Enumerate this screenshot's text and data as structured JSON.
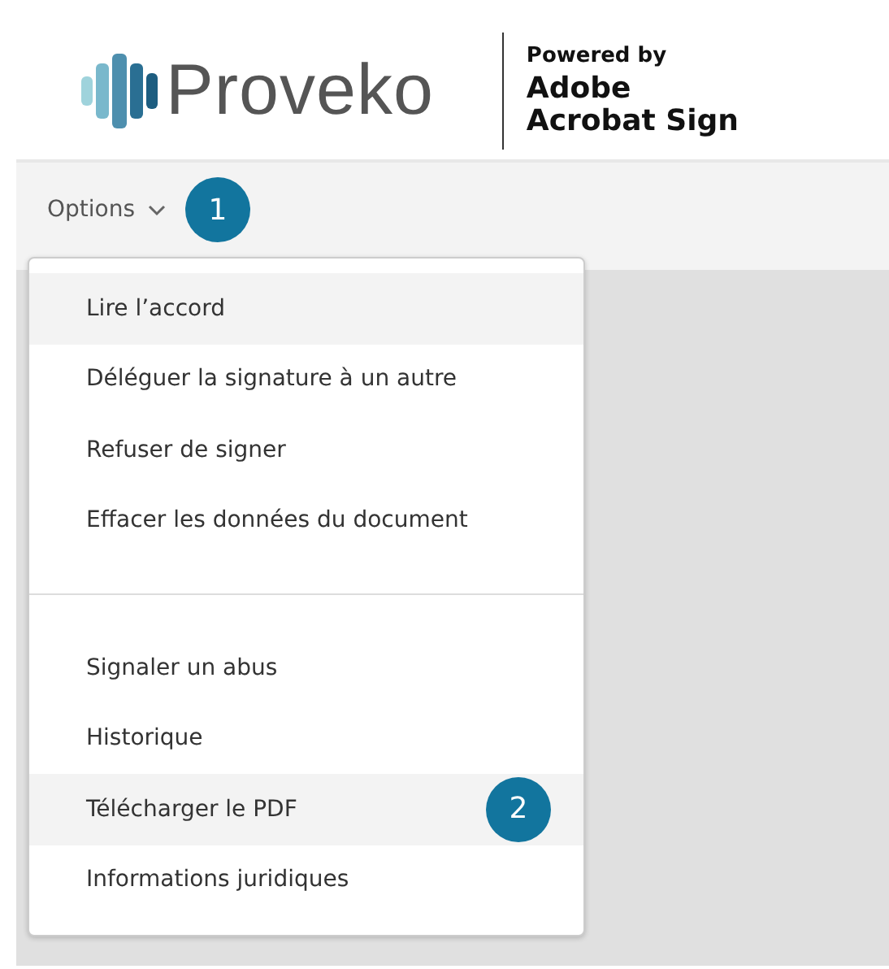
{
  "header": {
    "brand": "Proveko",
    "powered_by": "Powered by",
    "product_line_1": "Adobe",
    "product_line_2": "Acrobat Sign"
  },
  "toolbar": {
    "options_label": "Options",
    "callout": "1"
  },
  "menu": {
    "groups": [
      {
        "items": [
          {
            "label": "Lire l’accord",
            "selected": true
          },
          {
            "label": "Déléguer la signature à un autre",
            "selected": false
          },
          {
            "label": "Refuser de signer",
            "selected": false
          },
          {
            "label": "Effacer les données du document",
            "selected": false
          }
        ]
      },
      {
        "items": [
          {
            "label": "Signaler un abus",
            "selected": false
          },
          {
            "label": "Historique",
            "selected": false
          },
          {
            "label": "Télécharger le PDF",
            "selected": true,
            "callout": "2"
          },
          {
            "label": "Informations juridiques",
            "selected": false
          }
        ]
      }
    ]
  }
}
